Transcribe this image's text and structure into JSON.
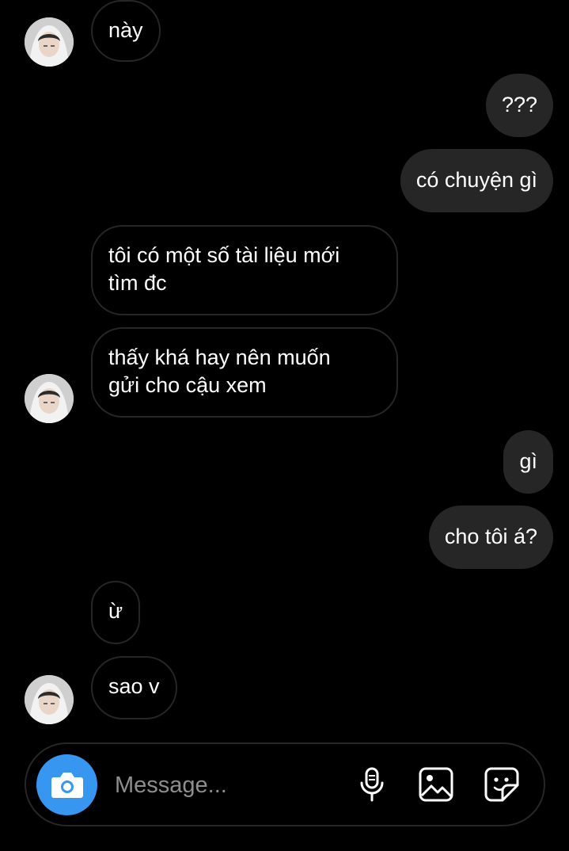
{
  "messages": [
    {
      "text": "này",
      "direction": "received"
    },
    {
      "text": "???",
      "direction": "sent"
    },
    {
      "text": "có chuyện gì",
      "direction": "sent"
    },
    {
      "text": "tôi có một số tài liệu mới\ntìm đc",
      "direction": "received"
    },
    {
      "text": "thấy khá hay nên muốn\ngửi cho cậu xem",
      "direction": "received"
    },
    {
      "text": "gì",
      "direction": "sent"
    },
    {
      "text": "cho tôi á?",
      "direction": "sent"
    },
    {
      "text": "ừ",
      "direction": "received"
    },
    {
      "text": "sao v",
      "direction": "received"
    }
  ],
  "composer": {
    "placeholder": "Message...",
    "camera_icon": "camera-icon",
    "mic_icon": "microphone-icon",
    "gallery_icon": "image-icon",
    "sticker_icon": "sticker-icon"
  },
  "colors": {
    "background": "#000000",
    "sent_bubble": "#262626",
    "received_border": "#262626",
    "accent": "#3797f0",
    "text": "#ffffff",
    "placeholder": "#8e8e8e"
  }
}
